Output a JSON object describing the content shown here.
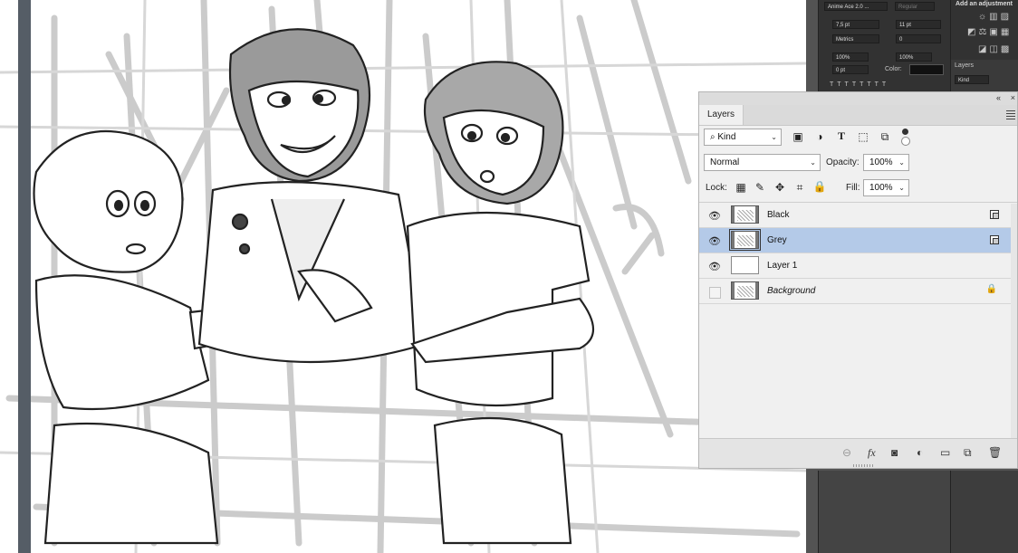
{
  "character_panel": {
    "font_family": "Anime Ace 2.0 ...",
    "font_style": "Regular",
    "font_size": "7,5 pt",
    "leading": "11 pt",
    "kerning": "Metrics",
    "tracking": "0",
    "vertical_scale": "100%",
    "horizontal_scale": "100%",
    "baseline_shift": "0 pt",
    "color_label": "Color:"
  },
  "adjustments_panel": {
    "title": "Add an adjustment"
  },
  "mini_layers": {
    "tab": "Layers",
    "filter": "Kind"
  },
  "layers_panel": {
    "tab_label": "Layers",
    "filter_kind": "Kind",
    "blend_mode": "Normal",
    "opacity_label": "Opacity:",
    "opacity_value": "100%",
    "lock_label": "Lock:",
    "fill_label": "Fill:",
    "fill_value": "100%",
    "layers": [
      {
        "name": "Black",
        "visible": true,
        "selected": false,
        "linked": true
      },
      {
        "name": "Grey",
        "visible": true,
        "selected": true,
        "linked": true
      },
      {
        "name": "Layer 1",
        "visible": true,
        "selected": false,
        "linked": false
      },
      {
        "name": "Background",
        "visible": false,
        "selected": false,
        "locked": true
      }
    ]
  },
  "colors": {
    "selected_row": "#b4cae8",
    "dock": "#535353",
    "panel": "#f0f0f0"
  }
}
